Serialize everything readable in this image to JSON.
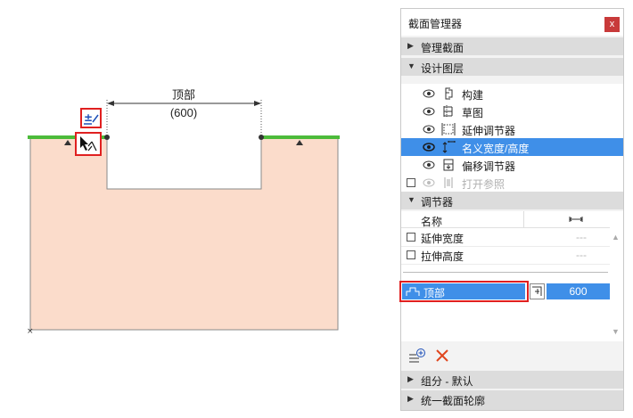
{
  "canvas": {
    "dimension_name": "顶部",
    "dimension_value": "(600)"
  },
  "panel": {
    "title": "截面管理器",
    "close_glyph": "x",
    "sections": [
      {
        "label": "管理截面",
        "state": "collapsed"
      },
      {
        "label": "设计图层",
        "state": "expanded"
      },
      {
        "label": "调节器",
        "state": "expanded"
      },
      {
        "label": "组分 - 默认",
        "state": "collapsed"
      },
      {
        "label": "统一截面轮廓",
        "state": "collapsed"
      }
    ],
    "layers": [
      {
        "label": "构建",
        "icon": "construction-icon"
      },
      {
        "label": "草图",
        "icon": "sketch-icon"
      },
      {
        "label": "延伸调节器",
        "icon": "stretch-adjuster-icon"
      },
      {
        "label": "名义宽度/高度",
        "icon": "nominal-size-icon",
        "selected": true
      },
      {
        "label": "偏移调节器",
        "icon": "offset-adjuster-icon"
      },
      {
        "label": "打开参照",
        "icon": "reference-icon",
        "disabled": true
      }
    ],
    "adjusters": {
      "name_header": "名称",
      "rows": [
        {
          "label": "延伸宽度",
          "value": "---"
        },
        {
          "label": "拉伸高度",
          "value": "---"
        }
      ],
      "selected": {
        "label": "顶部",
        "value": "600"
      }
    },
    "colors": {
      "accent": "#3f8fe8",
      "highlight": "#e02020",
      "profile_fill": "#fbdccb",
      "edge": "#4cbb3a"
    }
  }
}
